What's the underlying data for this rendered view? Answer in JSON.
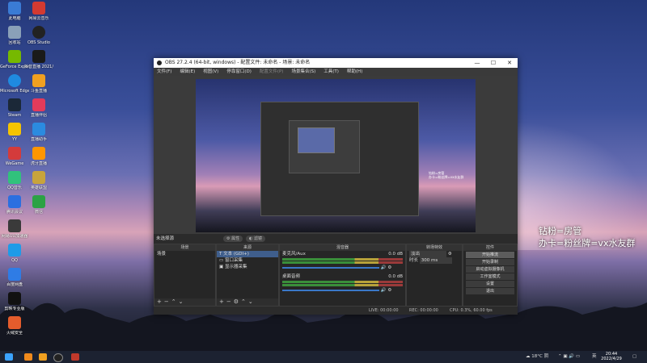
{
  "desktop": {
    "icons": [
      {
        "label": "此电脑",
        "color": "#3a7bd5"
      },
      {
        "label": "网易云音乐",
        "color": "#d33a31"
      },
      {
        "label": "回收站",
        "color": "#8aa0b8"
      },
      {
        "label": "OBS Studio",
        "color": "#222222"
      },
      {
        "label": "GeForce Experience",
        "color": "#76b900"
      },
      {
        "label": "抖音直播 2021/4/22",
        "color": "#1a1a1a"
      },
      {
        "label": "Microsoft Edge",
        "color": "#1f8ae0"
      },
      {
        "label": "斗鱼直播",
        "color": "#f0a020"
      },
      {
        "label": "Steam",
        "color": "#1b2838"
      },
      {
        "label": "直播伴侣",
        "color": "#e23b5b"
      },
      {
        "label": "YY",
        "color": "#f5c400"
      },
      {
        "label": "直播助手",
        "color": "#2b8be0"
      },
      {
        "label": "WeGame",
        "color": "#d43b3b"
      },
      {
        "label": "虎牙直播",
        "color": "#ff9600"
      },
      {
        "label": "QQ音乐",
        "color": "#31c27c"
      },
      {
        "label": "英雄联盟",
        "color": "#c8a43c"
      },
      {
        "label": "腾讯会议",
        "color": "#2b6fe0"
      },
      {
        "label": "微信",
        "color": "#2ba245"
      },
      {
        "label": "网易UU加速器",
        "color": "#3a3a3a"
      },
      {
        "label": "QQ",
        "color": "#1e9be8"
      },
      {
        "label": "百度网盘",
        "color": "#2f7ce5"
      },
      {
        "label": "剪映专业版",
        "color": "#111111"
      },
      {
        "label": "火绒安全",
        "color": "#e45c2c"
      }
    ]
  },
  "overlay": {
    "line1": "钻粉=房管",
    "line2": "办卡=粉丝牌=vx水友群"
  },
  "obs": {
    "title": "OBS 27.2.4 (64-bit, windows) - 配置文件: 未命名 - 场景: 未命名",
    "window_buttons": {
      "minimize": "—",
      "maximize": "☐",
      "close": "✕"
    },
    "menu": [
      "文件(F)",
      "编辑(E)",
      "视图(V)",
      "停靠窗口(D)",
      "配置文件(P)",
      "场景集合(S)",
      "工具(T)",
      "帮助(H)"
    ],
    "source_status": "未选择源",
    "props_button": "属性",
    "filters_button": "滤镜",
    "docks": {
      "scenes": {
        "title": "场景",
        "items": [
          "场景"
        ]
      },
      "sources": {
        "title": "来源",
        "items": [
          "文本 (GDI+)",
          "窗口采集",
          "显示器采集"
        ]
      },
      "mixer": {
        "title": "混音器",
        "channels": [
          {
            "name": "麦克风/Aux",
            "db": "0.0 dB"
          },
          {
            "name": "桌面音频",
            "db": "0.0 dB"
          }
        ]
      },
      "transitions": {
        "title": "转场特效",
        "type": "淡出",
        "duration_label": "时长",
        "duration": "300 ms"
      },
      "controls": {
        "title": "控件",
        "buttons": [
          "开始推流",
          "开始录制",
          "启动虚拟摄像机",
          "工作室模式",
          "设置",
          "退出"
        ]
      }
    },
    "statusbar": {
      "live": "LIVE: 00:00:00",
      "rec": "REC: 00:00:00",
      "cpu": "CPU: 0.3%, 60.00 fps"
    }
  },
  "taskbar": {
    "weather": "18°C 阴",
    "ime": "英",
    "time": "20:44",
    "date": "2022/4/29"
  }
}
